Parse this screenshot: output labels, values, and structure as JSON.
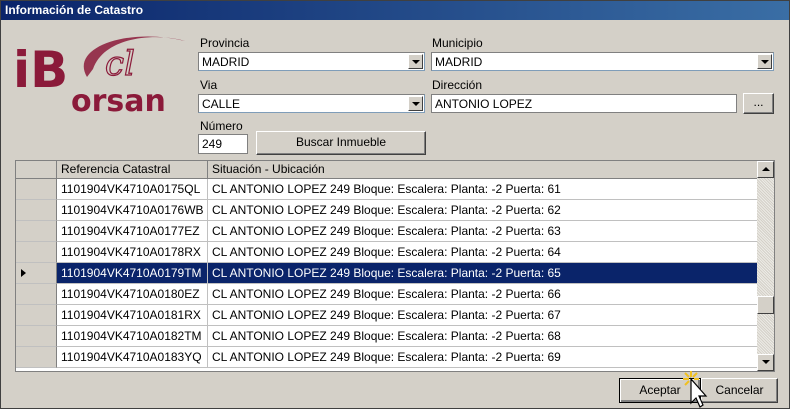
{
  "window": {
    "title": "Información de Catastro"
  },
  "logo": {
    "top_text": "iB",
    "bottom_text": "orsan",
    "script_text": "cl"
  },
  "form": {
    "provincia": {
      "label": "Provincia",
      "value": "MADRID"
    },
    "municipio": {
      "label": "Municipio",
      "value": "MADRID"
    },
    "via": {
      "label": "Via",
      "value": "CALLE"
    },
    "direccion": {
      "label": "Dirección",
      "value": "ANTONIO LOPEZ",
      "browse_label": "..."
    },
    "numero": {
      "label": "Número",
      "value": "249"
    },
    "search_button": "Buscar Inmueble"
  },
  "grid": {
    "columns": [
      "Referencia Catastral",
      "Situación - Ubicación"
    ],
    "selected_index": 4,
    "rows": [
      {
        "ref": "1101904VK4710A0175QL",
        "loc": "CL ANTONIO LOPEZ 249 Bloque:  Escalera:  Planta: -2 Puerta: 61"
      },
      {
        "ref": "1101904VK4710A0176WB",
        "loc": "CL ANTONIO LOPEZ 249 Bloque:  Escalera:  Planta: -2 Puerta: 62"
      },
      {
        "ref": "1101904VK4710A0177EZ",
        "loc": "CL ANTONIO LOPEZ 249 Bloque:  Escalera:  Planta: -2 Puerta: 63"
      },
      {
        "ref": "1101904VK4710A0178RX",
        "loc": "CL ANTONIO LOPEZ 249 Bloque:  Escalera:  Planta: -2 Puerta: 64"
      },
      {
        "ref": "1101904VK4710A0179TM",
        "loc": "CL ANTONIO LOPEZ 249 Bloque:  Escalera:  Planta: -2 Puerta: 65"
      },
      {
        "ref": "1101904VK4710A0180EZ",
        "loc": "CL ANTONIO LOPEZ 249 Bloque:  Escalera:  Planta: -2 Puerta: 66"
      },
      {
        "ref": "1101904VK4710A0181RX",
        "loc": "CL ANTONIO LOPEZ 249 Bloque:  Escalera:  Planta: -2 Puerta: 67"
      },
      {
        "ref": "1101904VK4710A0182TM",
        "loc": "CL ANTONIO LOPEZ 249 Bloque:  Escalera:  Planta: -2 Puerta: 68"
      },
      {
        "ref": "1101904VK4710A0183YQ",
        "loc": "CL ANTONIO LOPEZ 249 Bloque:  Escalera:  Planta: -2 Puerta: 69"
      }
    ]
  },
  "footer": {
    "accept_label": "Aceptar",
    "cancel_label": "Cancelar"
  },
  "colors": {
    "brand": "#8b1a3a",
    "selection": "#0a246a",
    "titlebar": "#0a246a"
  }
}
